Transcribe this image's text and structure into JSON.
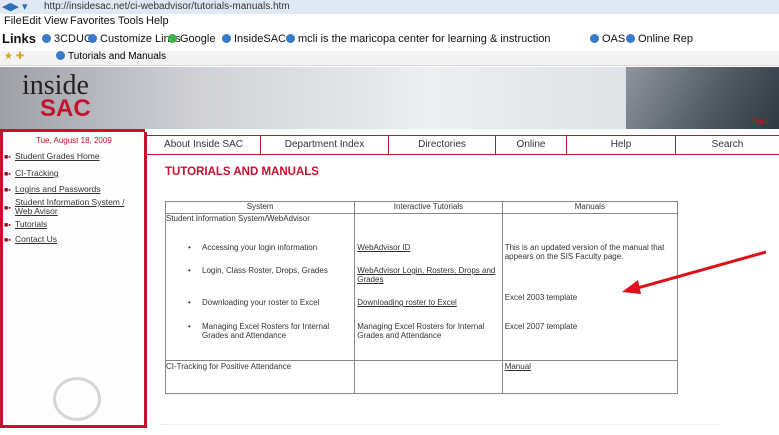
{
  "browser": {
    "url": "http://insidesac.net/ci-webadvisor/tutorials-manuals.htm",
    "menu": [
      "File",
      "Edit",
      "View",
      "Favorites",
      "Tools",
      "Help"
    ],
    "links_label": "Links",
    "links": [
      "3CDUG",
      "Customize Links",
      "Google",
      "InsideSAC",
      "mcli is the maricopa center for learning & instruction",
      "OAS",
      "Online Rep"
    ],
    "tab_title": "Tutorials and Manuals"
  },
  "banner": {
    "logo_top": "inside",
    "logo_bottom": "SAC",
    "photo_caption": "Sant"
  },
  "sidebar": {
    "date": "Tue, August 18, 2009",
    "items": [
      "Student Grades Home",
      "CI-Tracking",
      "Logins and Passwords",
      "Student Information System / Web Avisor",
      "Tutorials",
      "Contact Us"
    ]
  },
  "nav": {
    "tabs": [
      "About Inside SAC",
      "Department Index",
      "Directories",
      "Online",
      "Help",
      "Search"
    ]
  },
  "page": {
    "title": "TUTORIALS AND MANUALS"
  },
  "table": {
    "headers": [
      "System",
      "Interactive Tutorials",
      "Manuals"
    ],
    "section1": "Student Information System/WebAdvisor",
    "bullets": [
      "Accessing your login information",
      "Login, Class Roster, Drops, Grades",
      "Downloading your roster to Excel",
      "Managing Excel Rosters for Internal Grades and Attendance"
    ],
    "tutorials": [
      "WebAdvisor ID",
      "WebAdvisor Login, Rosters, Drops and Grades",
      "Downloading roster to Excel",
      "Managing Excel Rosters for Internal Grades and Attendance"
    ],
    "manual_note": "This is an updated version of the manual that appears on the SIS Faculty page.",
    "excel_2003": "Excel 2003 template",
    "excel_2007": "Excel 2007 template",
    "section2": "CI-Tracking for Positive Attendance",
    "manual_link": "Manual"
  },
  "colors": {
    "accent": "#c4122f",
    "arrow": "#e0101a"
  }
}
